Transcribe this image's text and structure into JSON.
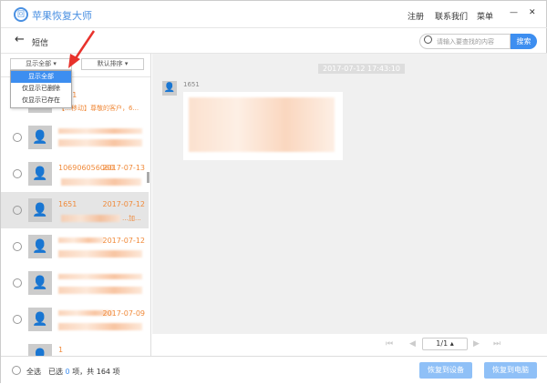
{
  "app": {
    "title": "苹果恢复大师",
    "logo_text": "回"
  },
  "titlebar": {
    "menu": [
      "注册",
      "联系我们",
      "菜单"
    ],
    "minimize": "—",
    "close": "✕"
  },
  "toolbar": {
    "back": "←",
    "title": "短信",
    "search_placeholder": "请输入要查找的内容",
    "search_button": "搜索"
  },
  "filters": {
    "show_value": "显示全部",
    "sort_value": "默认排序",
    "options": [
      "显示全部",
      "仅显示已删除",
      "仅显示已存在"
    ]
  },
  "messages": [
    {
      "name": "1581",
      "date": "",
      "preview": "【…移动】尊敬的客户，6..."
    },
    {
      "name": "",
      "date": "",
      "preview": ""
    },
    {
      "name": "106906056060",
      "date": "2017-07-13",
      "preview": ""
    },
    {
      "name": "1651",
      "date": "2017-07-12",
      "preview": "…加..."
    },
    {
      "name": "",
      "date": "2017-07-12",
      "preview": ""
    },
    {
      "name": "",
      "date": "",
      "preview": ""
    },
    {
      "name": "",
      "date": "2017-07-09",
      "preview": ""
    },
    {
      "name": "1",
      "date": "",
      "preview": ""
    }
  ],
  "conversation": {
    "timestamp": "2017-07-12 17:43:10",
    "sender": "1651"
  },
  "pager": {
    "value": "1/1"
  },
  "footer": {
    "select_all": "全选",
    "selected_prefix": "已选",
    "selected_count": "0",
    "selected_suffix": "项，共 164 项",
    "restore_device": "恢复到设备",
    "restore_pc": "恢复到电脑"
  }
}
